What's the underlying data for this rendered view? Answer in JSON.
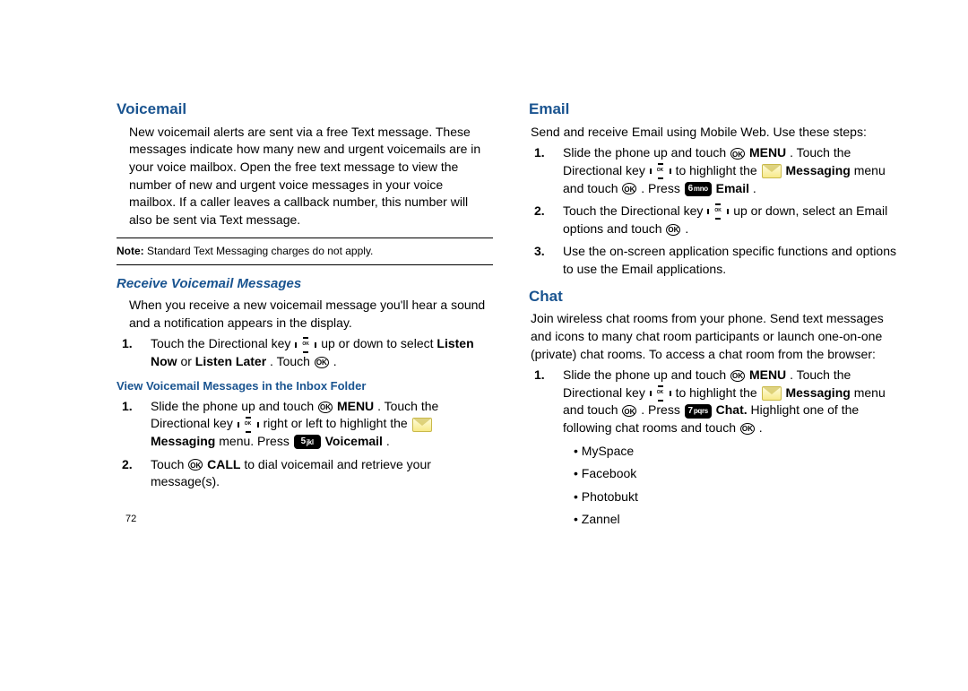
{
  "page_number": "72",
  "left": {
    "voicemail": {
      "heading": "Voicemail",
      "body": "New voicemail alerts are sent via a free Text message. These messages indicate how many new and urgent voicemails are in your voice mailbox. Open the free text message to view the number of new and urgent voice messages in your voice mailbox. If a caller leaves a callback number, this number will also be sent via Text message.",
      "note_label": "Note:",
      "note_text": " Standard Text Messaging charges do not apply.",
      "receive": {
        "heading": "Receive Voicemail Messages",
        "body": "When you receive a new voicemail message you'll hear a sound and a notification appears in the display.",
        "step1_a": "Touch the Directional key ",
        "step1_b": " up or down to select ",
        "step1_c": "Listen Now",
        "step1_d": " or ",
        "step1_e": "Listen Later",
        "step1_f": ". Touch ",
        "step1_g": " ."
      },
      "view": {
        "heading": "View Voicemail Messages in the Inbox Folder",
        "step1_a": "Slide the phone up and touch ",
        "step1_b": " ",
        "step1_menu": "MENU",
        "step1_c": ". Touch the Directional key ",
        "step1_d": " right or left to highlight the ",
        "step1_e": " ",
        "step1_msg": "Messaging",
        "step1_f": " menu. Press ",
        "step1_key": "5 jkl",
        "step1_g": " ",
        "step1_vm": "Voicemail",
        "step1_h": ".",
        "step2_a": "Touch ",
        "step2_b": " ",
        "step2_call": "CALL",
        "step2_c": " to dial voicemail and retrieve your message(s)."
      }
    }
  },
  "right": {
    "email": {
      "heading": "Email",
      "body": "Send and receive Email using Mobile Web. Use these steps:",
      "step1_a": "Slide the phone up and touch ",
      "step1_menu": "MENU",
      "step1_b": ". Touch the Directional key ",
      "step1_c": " to highlight the ",
      "step1_msg": "Messaging",
      "step1_d": " menu and touch ",
      "step1_e": " . Press ",
      "step1_key": "6mno",
      "step1_email": "Email",
      "step1_f": ".",
      "step2_a": "Touch the Directional key ",
      "step2_b": " up or down, select an Email options and touch ",
      "step2_c": " .",
      "step3": "Use the on-screen application specific functions and options to use the Email applications."
    },
    "chat": {
      "heading": "Chat",
      "body": "Join wireless chat rooms from your phone. Send text messages and icons to many chat room participants or launch one-on-one (private) chat rooms. To access a chat room from the browser:",
      "step1_a": "Slide the phone up and touch ",
      "step1_menu": "MENU",
      "step1_b": ". Touch the Directional key ",
      "step1_c": " to highlight the ",
      "step1_msg": "Messaging",
      "step1_d": " menu and touch ",
      "step1_e": " . Press ",
      "step1_key": "7pqrs",
      "step1_chat": "Chat.",
      "step1_f": " Highlight one of the following chat rooms and touch ",
      "step1_g": " .",
      "bullets": [
        "MySpace",
        "Facebook",
        "Photobukt",
        "Zannel"
      ]
    }
  },
  "icons": {
    "ok_label": "OK",
    "dpad_center": "OK"
  }
}
